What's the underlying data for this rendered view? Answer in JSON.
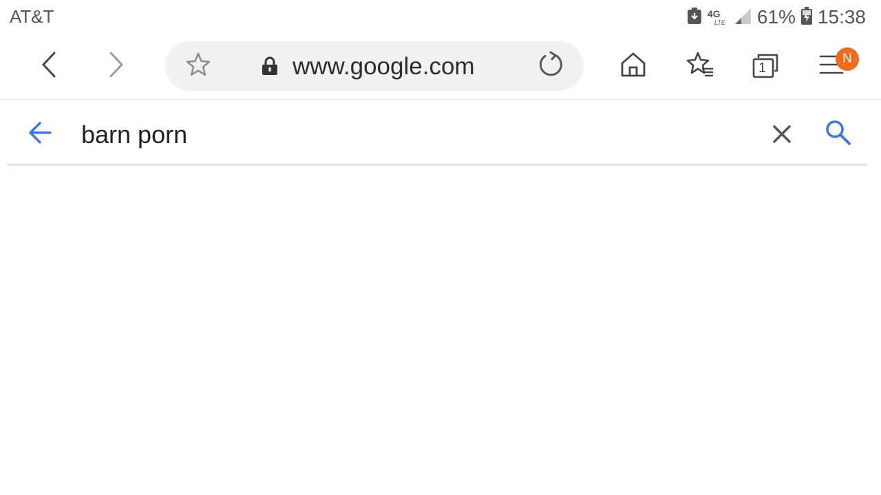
{
  "status_bar": {
    "carrier": "AT&T",
    "network_label": "4G",
    "network_sub": "LTE",
    "battery_percent": "61%",
    "time": "15:38",
    "icons": [
      "download-notification-icon",
      "lte-signal-icon",
      "cell-signal-icon",
      "battery-charging-icon"
    ]
  },
  "browser": {
    "url": "www.google.com",
    "tab_count": "1",
    "menu_badge": "N",
    "icons": [
      "back-icon",
      "forward-icon",
      "bookmark-star-icon",
      "lock-icon",
      "reload-icon",
      "home-icon",
      "bookmarks-icon",
      "tabs-icon",
      "menu-icon"
    ]
  },
  "search": {
    "query": "barn porn",
    "icons": [
      "search-back-arrow-icon",
      "clear-icon",
      "search-icon"
    ]
  },
  "colors": {
    "accent_blue": "#3b78e7",
    "pill_bg": "#f1f1f1",
    "badge_orange": "#f26b1d",
    "icon_gray": "#555555"
  }
}
